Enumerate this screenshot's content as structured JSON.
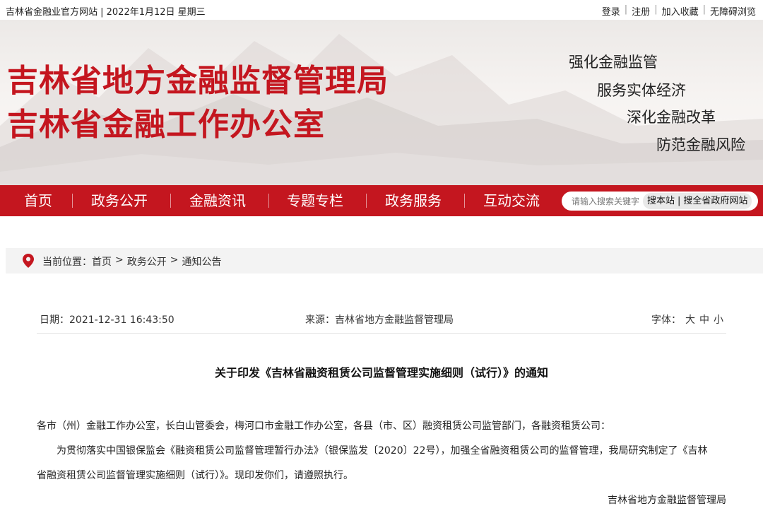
{
  "topbar": {
    "site_info": "吉林省金融业官方网站 | 2022年1月12日 星期三",
    "links": [
      "登录",
      "注册",
      "加入收藏",
      "无障碍浏览"
    ]
  },
  "banner": {
    "title_line1": "吉林省地方金融监督管理局",
    "title_line2": "吉林省金融工作办公室",
    "slogans": [
      "强化金融监管",
      "服务实体经济",
      "深化金融改革",
      "防范金融风险"
    ]
  },
  "nav": {
    "items": [
      "首页",
      "政务公开",
      "金融资讯",
      "专题专栏",
      "政务服务",
      "互动交流"
    ],
    "search_placeholder": "请输入搜索关键字",
    "search_site": "搜本站",
    "search_sep": "|",
    "search_all": "搜全省政府网站"
  },
  "breadcrumb": {
    "prefix": "当前位置：",
    "items": [
      "首页",
      "政务公开",
      "通知公告"
    ],
    "arrow": ">"
  },
  "meta": {
    "date": "日期：2021-12-31 16:43:50",
    "source": "来源：吉林省地方金融监督管理局",
    "font_label": "字体：",
    "font_sizes": [
      "大",
      "中",
      "小"
    ]
  },
  "article": {
    "title": "关于印发《吉林省融资租赁公司监督管理实施细则（试行）》的通知",
    "para1": "各市（州）金融工作办公室，长白山管委会，梅河口市金融工作办公室，各县（市、区）融资租赁公司监管部门，各融资租赁公司：",
    "para2_line1": "为贯彻落实中国银保监会《融资租赁公司监督管理暂行办法》（银保监发〔2020〕22号），加强全省融资租赁公司的监督管理，我局研究制定了《吉林",
    "para2_line2": "省融资租赁公司监督管理实施细则（试行）》。现印发你们，请遵照执行。",
    "signature": "吉林省地方金融监督管理局"
  },
  "colors": {
    "brand_red": "#c4161f",
    "crumb_bg": "#f3f3f3"
  }
}
